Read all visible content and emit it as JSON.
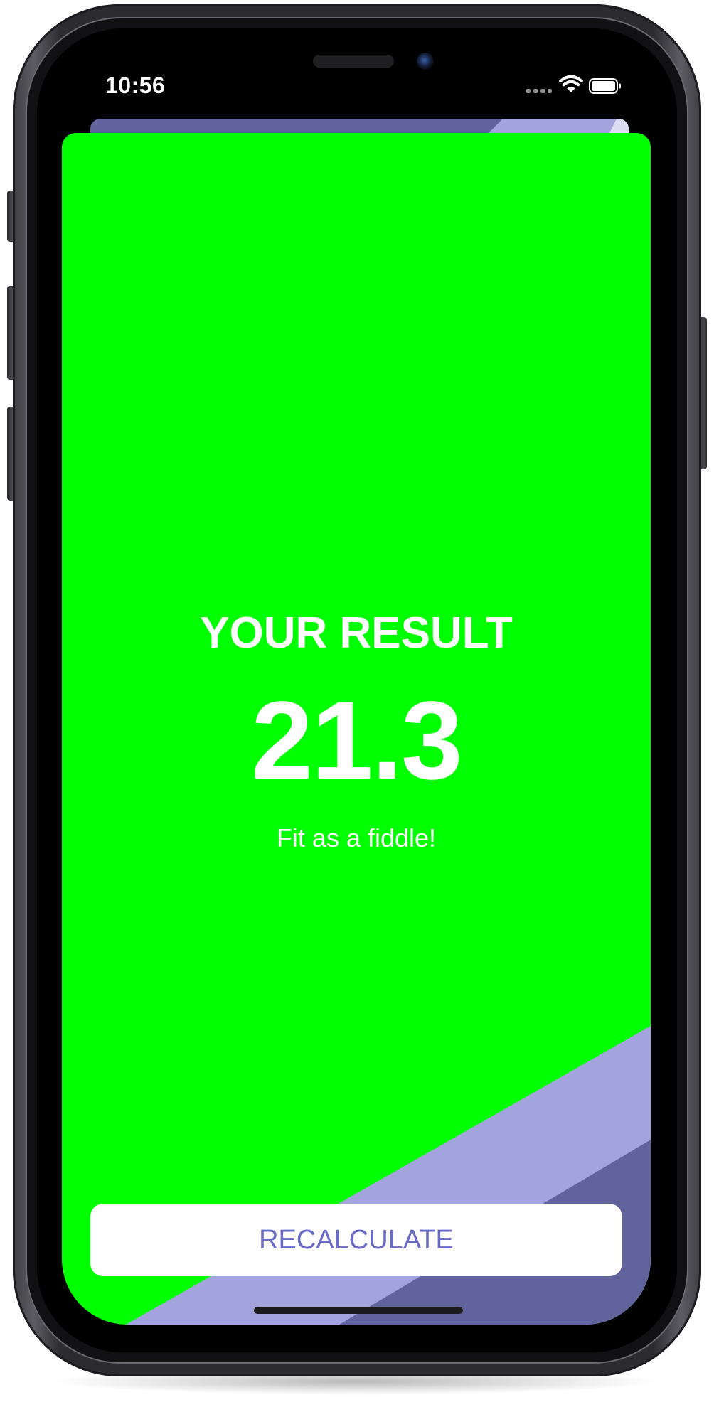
{
  "status_bar": {
    "time": "10:56"
  },
  "result": {
    "title": "YOUR RESULT",
    "value": "21.3",
    "message": "Fit as a fiddle!"
  },
  "actions": {
    "recalculate_label": "RECALCULATE"
  },
  "colors": {
    "card_background": "#00ff00",
    "stripe_light": "#a3a3de",
    "stripe_dark": "#61649c",
    "button_background": "#ffffff",
    "button_text": "#6a6ac8",
    "text_primary": "#ffffff"
  },
  "icons": [
    "signal-icon",
    "wifi-icon",
    "battery-icon"
  ]
}
